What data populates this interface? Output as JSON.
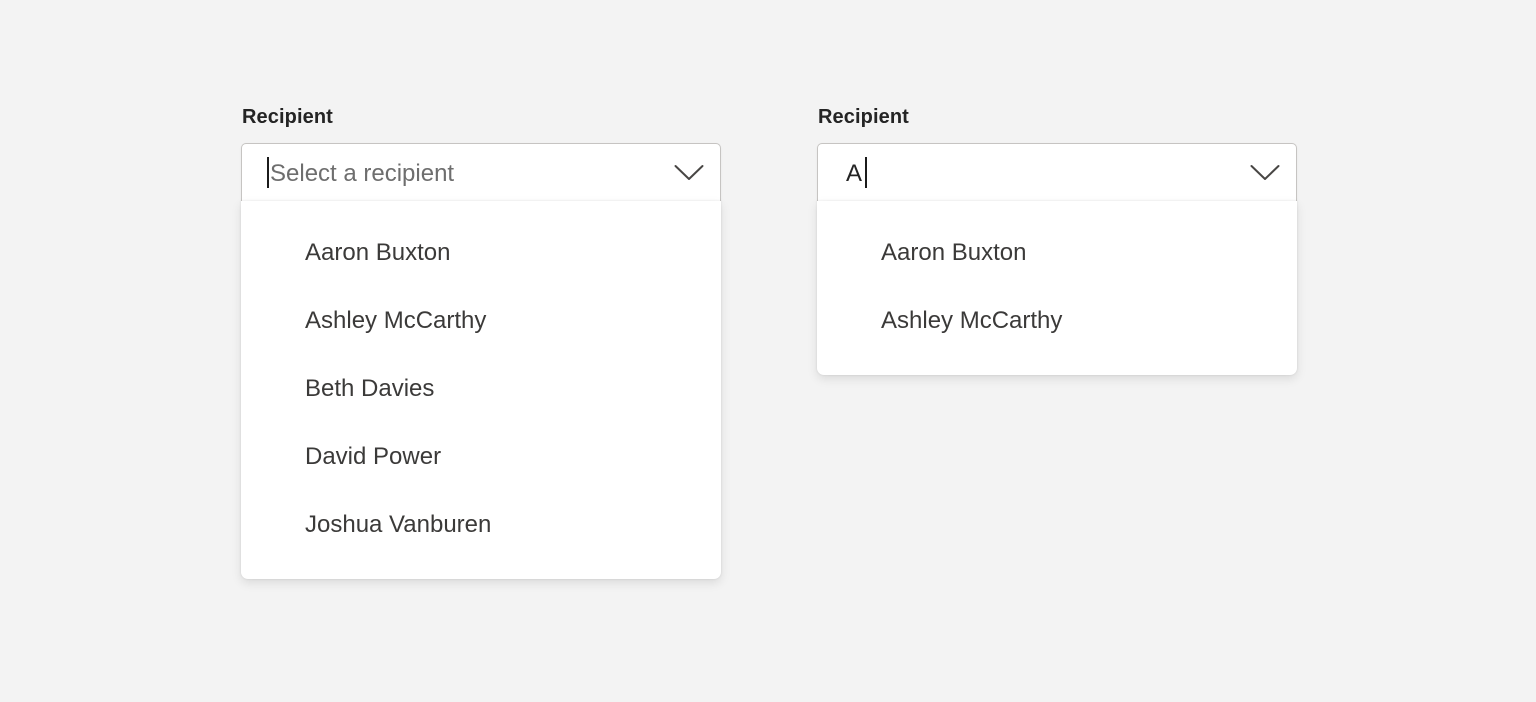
{
  "theme": {
    "background": "#f3f3f3",
    "accent": "#1268b3",
    "field_border": "#c6c4c2",
    "text_primary": "#242424",
    "text_option": "#3b3a39",
    "placeholder": "#6e6e6e",
    "surface": "#ffffff"
  },
  "comboboxes": [
    {
      "id": "recipient-empty",
      "label": "Recipient",
      "value": "",
      "placeholder": "Select a recipient",
      "caret_position": "leading",
      "expand_icon": "chevron-down-icon",
      "expanded": true,
      "options": [
        "Aaron Buxton",
        "Ashley McCarthy",
        "Beth Davies",
        "David Power",
        "Joshua Vanburen"
      ]
    },
    {
      "id": "recipient-filtered",
      "label": "Recipient",
      "value": "A",
      "placeholder": "Select a recipient",
      "caret_position": "trailing",
      "expand_icon": "chevron-down-icon",
      "expanded": true,
      "options": [
        "Aaron Buxton",
        "Ashley McCarthy"
      ]
    }
  ]
}
